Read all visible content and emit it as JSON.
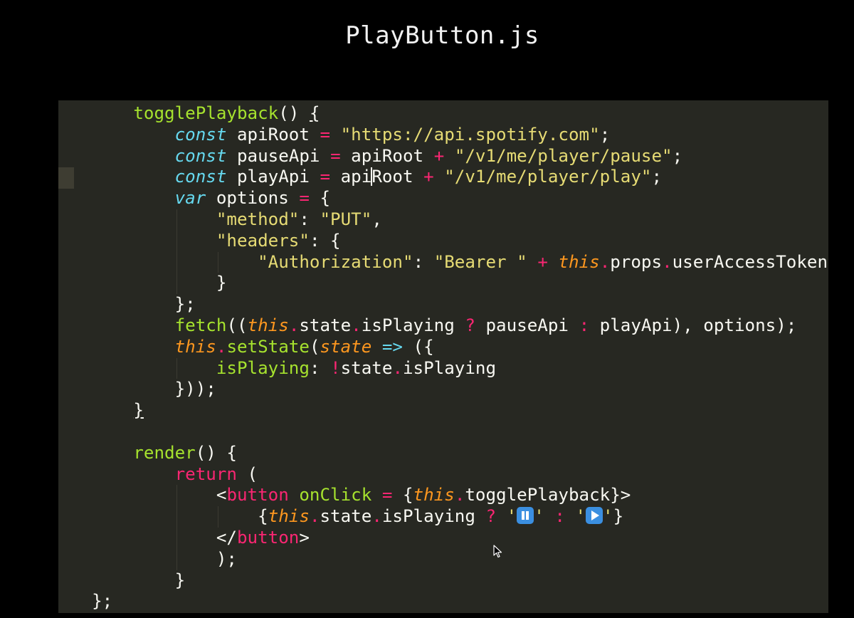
{
  "slide": {
    "title": "PlayButton.js"
  },
  "editor": {
    "language": "javascript",
    "lines": [
      [
        {
          "c": "p",
          "t": "      "
        },
        {
          "c": "f",
          "t": "togglePlayback"
        },
        {
          "c": "p",
          "t": "() "
        },
        {
          "c": "p u",
          "t": "{"
        }
      ],
      [
        {
          "c": "p",
          "t": "          "
        },
        {
          "c": "st",
          "t": "const"
        },
        {
          "c": "p",
          "t": " apiRoot "
        },
        {
          "c": "k",
          "t": "="
        },
        {
          "c": "p",
          "t": " "
        },
        {
          "c": "s",
          "t": "\"https://api.spotify.com\""
        },
        {
          "c": "p",
          "t": ";"
        }
      ],
      [
        {
          "c": "p",
          "t": "          "
        },
        {
          "c": "st",
          "t": "const"
        },
        {
          "c": "p",
          "t": " pauseApi "
        },
        {
          "c": "k",
          "t": "="
        },
        {
          "c": "p",
          "t": " apiRoot "
        },
        {
          "c": "k",
          "t": "+"
        },
        {
          "c": "p",
          "t": " "
        },
        {
          "c": "s",
          "t": "\"/v1/me/player/pause\""
        },
        {
          "c": "p",
          "t": ";"
        }
      ],
      [
        {
          "c": "p",
          "t": "          "
        },
        {
          "c": "st",
          "t": "const"
        },
        {
          "c": "p",
          "t": " playApi "
        },
        {
          "c": "k",
          "t": "="
        },
        {
          "c": "p",
          "t": " api"
        },
        {
          "c": "cursor",
          "t": ""
        },
        {
          "c": "p",
          "t": "Root "
        },
        {
          "c": "k",
          "t": "+"
        },
        {
          "c": "p",
          "t": " "
        },
        {
          "c": "s",
          "t": "\"/v1/me/player/play\""
        },
        {
          "c": "p",
          "t": ";"
        }
      ],
      [
        {
          "c": "p",
          "t": "          "
        },
        {
          "c": "st",
          "t": "var"
        },
        {
          "c": "p",
          "t": " options "
        },
        {
          "c": "k",
          "t": "="
        },
        {
          "c": "p",
          "t": " {"
        }
      ],
      [
        {
          "c": "p",
          "t": "              "
        },
        {
          "c": "s",
          "t": "\"method\""
        },
        {
          "c": "p",
          "t": ": "
        },
        {
          "c": "s",
          "t": "\"PUT\""
        },
        {
          "c": "p",
          "t": ","
        }
      ],
      [
        {
          "c": "p",
          "t": "              "
        },
        {
          "c": "s",
          "t": "\"headers\""
        },
        {
          "c": "p",
          "t": ": {"
        }
      ],
      [
        {
          "c": "p",
          "t": "                  "
        },
        {
          "c": "s",
          "t": "\"Authorization\""
        },
        {
          "c": "p",
          "t": ": "
        },
        {
          "c": "s",
          "t": "\"Bearer \""
        },
        {
          "c": "p",
          "t": " "
        },
        {
          "c": "k",
          "t": "+"
        },
        {
          "c": "p",
          "t": " "
        },
        {
          "c": "t",
          "t": "this"
        },
        {
          "c": "k",
          "t": "."
        },
        {
          "c": "p",
          "t": "props"
        },
        {
          "c": "k",
          "t": "."
        },
        {
          "c": "p",
          "t": "userAccessToken"
        }
      ],
      [
        {
          "c": "p",
          "t": "              }"
        }
      ],
      [
        {
          "c": "p",
          "t": "          };"
        }
      ],
      [
        {
          "c": "p",
          "t": "          "
        },
        {
          "c": "f",
          "t": "fetch"
        },
        {
          "c": "p",
          "t": "(("
        },
        {
          "c": "t",
          "t": "this"
        },
        {
          "c": "k",
          "t": "."
        },
        {
          "c": "p",
          "t": "state"
        },
        {
          "c": "k",
          "t": "."
        },
        {
          "c": "p",
          "t": "isPlaying "
        },
        {
          "c": "k",
          "t": "?"
        },
        {
          "c": "p",
          "t": " pauseApi "
        },
        {
          "c": "k",
          "t": ":"
        },
        {
          "c": "p",
          "t": " playApi), options);"
        }
      ],
      [
        {
          "c": "p",
          "t": "          "
        },
        {
          "c": "t",
          "t": "this"
        },
        {
          "c": "k",
          "t": "."
        },
        {
          "c": "f",
          "t": "setState"
        },
        {
          "c": "p",
          "t": "("
        },
        {
          "c": "t",
          "t": "state"
        },
        {
          "c": "p",
          "t": " "
        },
        {
          "c": "st",
          "t": "=>"
        },
        {
          "c": "p",
          "t": " ({"
        }
      ],
      [
        {
          "c": "p",
          "t": "              "
        },
        {
          "c": "f",
          "t": "isPlaying"
        },
        {
          "c": "p",
          "t": ": "
        },
        {
          "c": "k",
          "t": "!"
        },
        {
          "c": "p",
          "t": "state"
        },
        {
          "c": "k",
          "t": "."
        },
        {
          "c": "p",
          "t": "isPlaying"
        }
      ],
      [
        {
          "c": "p",
          "t": "          }));"
        }
      ],
      [
        {
          "c": "p",
          "t": "      "
        },
        {
          "c": "p u",
          "t": "}"
        }
      ],
      [
        {
          "c": "p",
          "t": ""
        }
      ],
      [
        {
          "c": "p",
          "t": "      "
        },
        {
          "c": "f",
          "t": "render"
        },
        {
          "c": "p",
          "t": "() {"
        }
      ],
      [
        {
          "c": "p",
          "t": "          "
        },
        {
          "c": "k",
          "t": "return"
        },
        {
          "c": "p",
          "t": " ("
        }
      ],
      [
        {
          "c": "p",
          "t": "              <"
        },
        {
          "c": "k",
          "t": "button"
        },
        {
          "c": "p",
          "t": " "
        },
        {
          "c": "f",
          "t": "onClick"
        },
        {
          "c": "p",
          "t": " "
        },
        {
          "c": "k",
          "t": "="
        },
        {
          "c": "p",
          "t": " {"
        },
        {
          "c": "t",
          "t": "this"
        },
        {
          "c": "k",
          "t": "."
        },
        {
          "c": "p",
          "t": "togglePlayback}>"
        }
      ],
      [
        {
          "c": "p",
          "t": "                  {"
        },
        {
          "c": "t",
          "t": "this"
        },
        {
          "c": "k",
          "t": "."
        },
        {
          "c": "p",
          "t": "state"
        },
        {
          "c": "k",
          "t": "."
        },
        {
          "c": "p",
          "t": "isPlaying "
        },
        {
          "c": "k",
          "t": "?"
        },
        {
          "c": "p",
          "t": " "
        },
        {
          "c": "s",
          "t": "'"
        },
        {
          "c": "emoji-pause",
          "t": ""
        },
        {
          "c": "s",
          "t": "'"
        },
        {
          "c": "p",
          "t": " "
        },
        {
          "c": "k",
          "t": ":"
        },
        {
          "c": "p",
          "t": " "
        },
        {
          "c": "s",
          "t": "'"
        },
        {
          "c": "emoji-play",
          "t": ""
        },
        {
          "c": "s",
          "t": "'"
        },
        {
          "c": "p",
          "t": "}"
        }
      ],
      [
        {
          "c": "p",
          "t": "              </"
        },
        {
          "c": "k",
          "t": "button"
        },
        {
          "c": "p",
          "t": ">"
        }
      ],
      [
        {
          "c": "p",
          "t": "              );"
        }
      ],
      [
        {
          "c": "p",
          "t": "          }"
        }
      ],
      [
        {
          "c": "p",
          "t": "  };"
        }
      ]
    ],
    "icons": {
      "pause_emoji": "pause-button-emoji",
      "play_emoji": "play-button-emoji",
      "mouse_cursor": "arrow-pointer"
    },
    "colors": {
      "background": "#272822",
      "keyword": "#f92672",
      "string": "#e6db74",
      "function": "#a6e22e",
      "storage": "#66d9ef",
      "this": "#fd971f",
      "plain": "#f8f8f2"
    }
  }
}
